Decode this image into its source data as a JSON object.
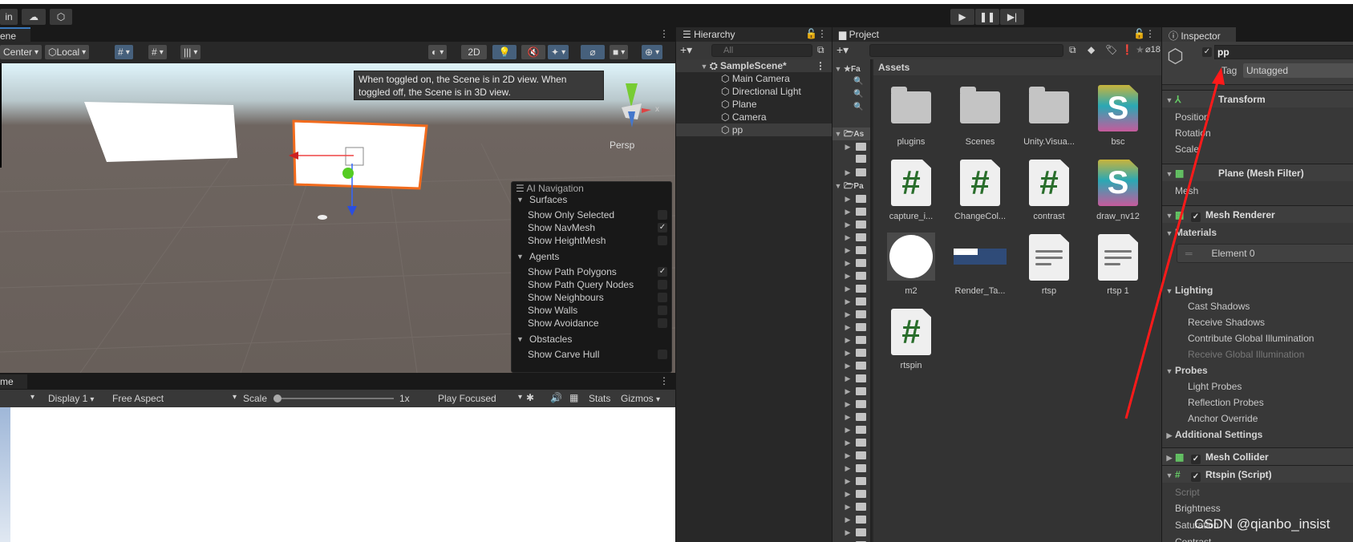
{
  "main_toolbar": {
    "account_label": "in",
    "cloud_icon": "cloud-icon",
    "collab_icon": "hexagon-icon",
    "play_icon": "play-icon",
    "pause_icon": "pause-icon",
    "step_icon": "step-icon"
  },
  "scene": {
    "tab_label": "ene",
    "pivot_label": "Center",
    "space_label": "Local",
    "mode_2d_label": "2D",
    "persp_label": "Persp",
    "tooltip": "When toggled on, the Scene is in 2D view. When toggled off, the Scene is in 3D view.",
    "accent_selected": "#f26b1d"
  },
  "ai_navigation": {
    "title": "AI Navigation",
    "sections": [
      {
        "label": "Surfaces",
        "items": [
          {
            "label": "Show Only Selected",
            "checked": false
          },
          {
            "label": "Show NavMesh",
            "checked": true
          },
          {
            "label": "Show HeightMesh",
            "checked": false
          }
        ]
      },
      {
        "label": "Agents",
        "items": [
          {
            "label": "Show Path Polygons",
            "checked": true
          },
          {
            "label": "Show Path Query Nodes",
            "checked": false
          },
          {
            "label": "Show Neighbours",
            "checked": false
          },
          {
            "label": "Show Walls",
            "checked": false
          },
          {
            "label": "Show Avoidance",
            "checked": false
          }
        ]
      },
      {
        "label": "Obstacles",
        "items": [
          {
            "label": "Show Carve Hull",
            "checked": false
          }
        ]
      }
    ]
  },
  "game": {
    "tab_label": "me",
    "display_label": "Display 1",
    "aspect_label": "Free Aspect",
    "scale_label": "Scale",
    "scale_value": "1x",
    "play_mode_label": "Play Focused",
    "stats_label": "Stats",
    "gizmos_label": "Gizmos"
  },
  "hierarchy": {
    "tab_label": "Hierarchy",
    "search_placeholder": "All",
    "scene_name": "SampleScene*",
    "items": [
      "Main Camera",
      "Directional Light",
      "Plane",
      "Camera",
      "pp"
    ],
    "selected": "pp"
  },
  "project": {
    "tab_label": "Project",
    "hidden_count": "18",
    "favorites_label": "Fa",
    "assets_tree_label": "As",
    "packages_tree_label": "Pa",
    "breadcrumb": "Assets",
    "assets": [
      {
        "name": "plugins",
        "type": "folder"
      },
      {
        "name": "Scenes",
        "type": "folder"
      },
      {
        "name": "Unity.Visua...",
        "type": "folder"
      },
      {
        "name": "bsc",
        "type": "shader"
      },
      {
        "name": "capture_i...",
        "type": "script"
      },
      {
        "name": "ChangeCol...",
        "type": "script"
      },
      {
        "name": "contrast",
        "type": "script"
      },
      {
        "name": "draw_nv12",
        "type": "shader"
      },
      {
        "name": "m2",
        "type": "material"
      },
      {
        "name": "Render_Ta...",
        "type": "render-texture"
      },
      {
        "name": "rtsp",
        "type": "text"
      },
      {
        "name": "rtsp 1",
        "type": "text"
      },
      {
        "name": "rtspin",
        "type": "script"
      }
    ]
  },
  "inspector": {
    "tab_label": "Inspector",
    "object_name": "pp",
    "active": true,
    "tag_label": "Tag",
    "tag_value": "Untagged",
    "transform": {
      "title": "Transform",
      "rows": [
        "Position",
        "Rotation",
        "Scale"
      ]
    },
    "mesh_filter": {
      "title": "Plane (Mesh Filter)",
      "rows": [
        "Mesh"
      ]
    },
    "mesh_renderer": {
      "title": "Mesh Renderer",
      "enabled": true,
      "materials_label": "Materials",
      "element_label": "Element 0",
      "lighting_label": "Lighting",
      "lighting_rows": [
        "Cast Shadows",
        "Receive Shadows",
        "Contribute Global Illumination"
      ],
      "lighting_disabled_row": "Receive Global Illumination",
      "probes_label": "Probes",
      "probes_rows": [
        "Light Probes",
        "Reflection Probes",
        "Anchor Override"
      ],
      "additional_label": "Additional Settings"
    },
    "mesh_collider": {
      "title": "Mesh Collider",
      "enabled": true
    },
    "script": {
      "title": "Rtspin (Script)",
      "enabled": true,
      "script_row": "Script",
      "rows": [
        "Brightness",
        "Saturation",
        "Contrast"
      ]
    }
  },
  "watermark": "CSDN @qianbo_insist",
  "annotation_arrow_color": "#ff1a1a"
}
